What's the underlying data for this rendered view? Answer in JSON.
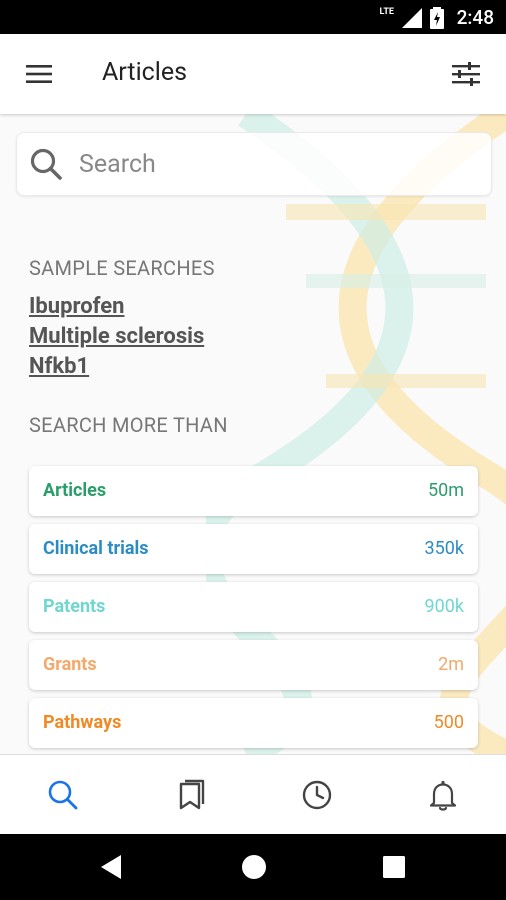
{
  "status_bar": {
    "time": "2:48",
    "network": "LTE"
  },
  "app_bar": {
    "title": "Articles"
  },
  "search": {
    "placeholder": "Search"
  },
  "sample_searches": {
    "heading": "SAMPLE SEARCHES",
    "items": [
      "Ibuprofen",
      "Multiple sclerosis",
      "Nfkb1"
    ]
  },
  "search_more": {
    "heading": "SEARCH MORE THAN",
    "cards": [
      {
        "label": "Articles",
        "count": "50m",
        "color": "#2a9d6a"
      },
      {
        "label": "Clinical trials",
        "count": "350k",
        "color": "#2b8cc4"
      },
      {
        "label": "Patents",
        "count": "900k",
        "color": "#6fd6d0"
      },
      {
        "label": "Grants",
        "count": "2m",
        "color": "#f4a96a"
      },
      {
        "label": "Pathways",
        "count": "500",
        "color": "#f08a24"
      }
    ]
  },
  "bottom_nav": {
    "items": [
      "search-icon",
      "bookmarks-icon",
      "history-icon",
      "notifications-icon"
    ],
    "active": "search-icon",
    "active_color": "#1a73e8"
  },
  "system_nav": [
    "back-icon",
    "home-icon",
    "recents-icon"
  ]
}
